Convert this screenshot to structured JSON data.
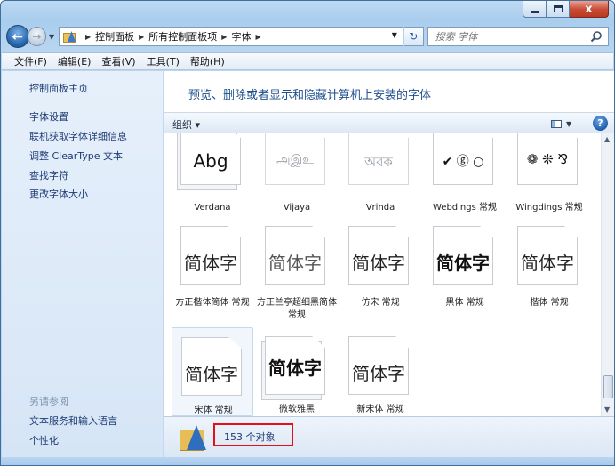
{
  "window": {
    "minimize": "",
    "maximize": "",
    "close": "x"
  },
  "address": {
    "crumbs": [
      "控制面板",
      "所有控制面板项",
      "字体"
    ],
    "search_placeholder": "搜索 字体"
  },
  "menu": [
    "文件(F)",
    "编辑(E)",
    "查看(V)",
    "工具(T)",
    "帮助(H)"
  ],
  "sidebar": {
    "home": "控制面板主页",
    "links": [
      "字体设置",
      "联机获取字体详细信息",
      "调整 ClearType 文本",
      "查找字符",
      "更改字体大小"
    ],
    "see_also_title": "另请参阅",
    "see_also": [
      "文本服务和输入语言",
      "个性化"
    ]
  },
  "main": {
    "title": "预览、删除或者显示和隐藏计算机上安装的字体",
    "organize": "组织 ▾",
    "help": "?"
  },
  "fonts": [
    {
      "name": "Verdana",
      "preview": "Abg"
    },
    {
      "name": "Vijaya",
      "preview": "அஇஉ"
    },
    {
      "name": "Vrinda",
      "preview": "অবক"
    },
    {
      "name": "Webdings 常规",
      "preview": "✔ ⓖ ○"
    },
    {
      "name": "Wingdings 常规",
      "preview": "❁ ❊ ⅋"
    },
    {
      "name": "方正楷体简体 常规",
      "preview": "简体字"
    },
    {
      "name": "方正兰亭超细黑简体 常规",
      "preview": "简体字"
    },
    {
      "name": "仿宋 常规",
      "preview": "简体字"
    },
    {
      "name": "黑体 常规",
      "preview": "简体字"
    },
    {
      "name": "楷体 常规",
      "preview": "简体字"
    },
    {
      "name": "宋体 常规",
      "preview": "简体字"
    },
    {
      "name": "微软雅黑",
      "preview": "简体字"
    },
    {
      "name": "新宋体 常规",
      "preview": "简体字"
    }
  ],
  "status": {
    "count": "153 个对象"
  },
  "colors": {
    "link": "#1e3b74",
    "title": "#1e4f8e",
    "highlight_box": "#e3101a"
  }
}
